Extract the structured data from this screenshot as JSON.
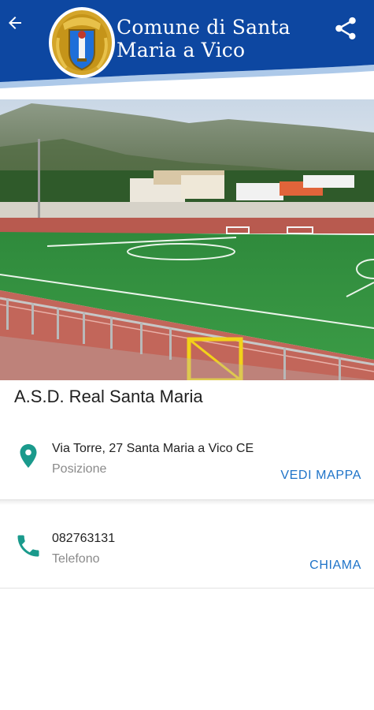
{
  "header": {
    "title_line1": "Comune di Santa",
    "title_line2": "Maria a Vico",
    "back_icon": "arrow-back-icon",
    "share_icon": "share-icon",
    "crest_icon": "municipal-crest",
    "colors": {
      "band": "#0d47a1",
      "crest_gold": "#d4a52a"
    }
  },
  "place": {
    "name": "A.S.D. Real Santa Maria"
  },
  "address": {
    "value": "Via Torre, 27 Santa Maria a Vico CE",
    "label": "Posizione",
    "action": "VEDI MAPPA",
    "icon": "location-pin-icon"
  },
  "phone": {
    "value": "082763131",
    "label": "Telefono",
    "action": "CHIAMA",
    "icon": "phone-icon"
  },
  "colors": {
    "accent_teal": "#1a9a8c",
    "link_blue": "#1e73c8"
  }
}
